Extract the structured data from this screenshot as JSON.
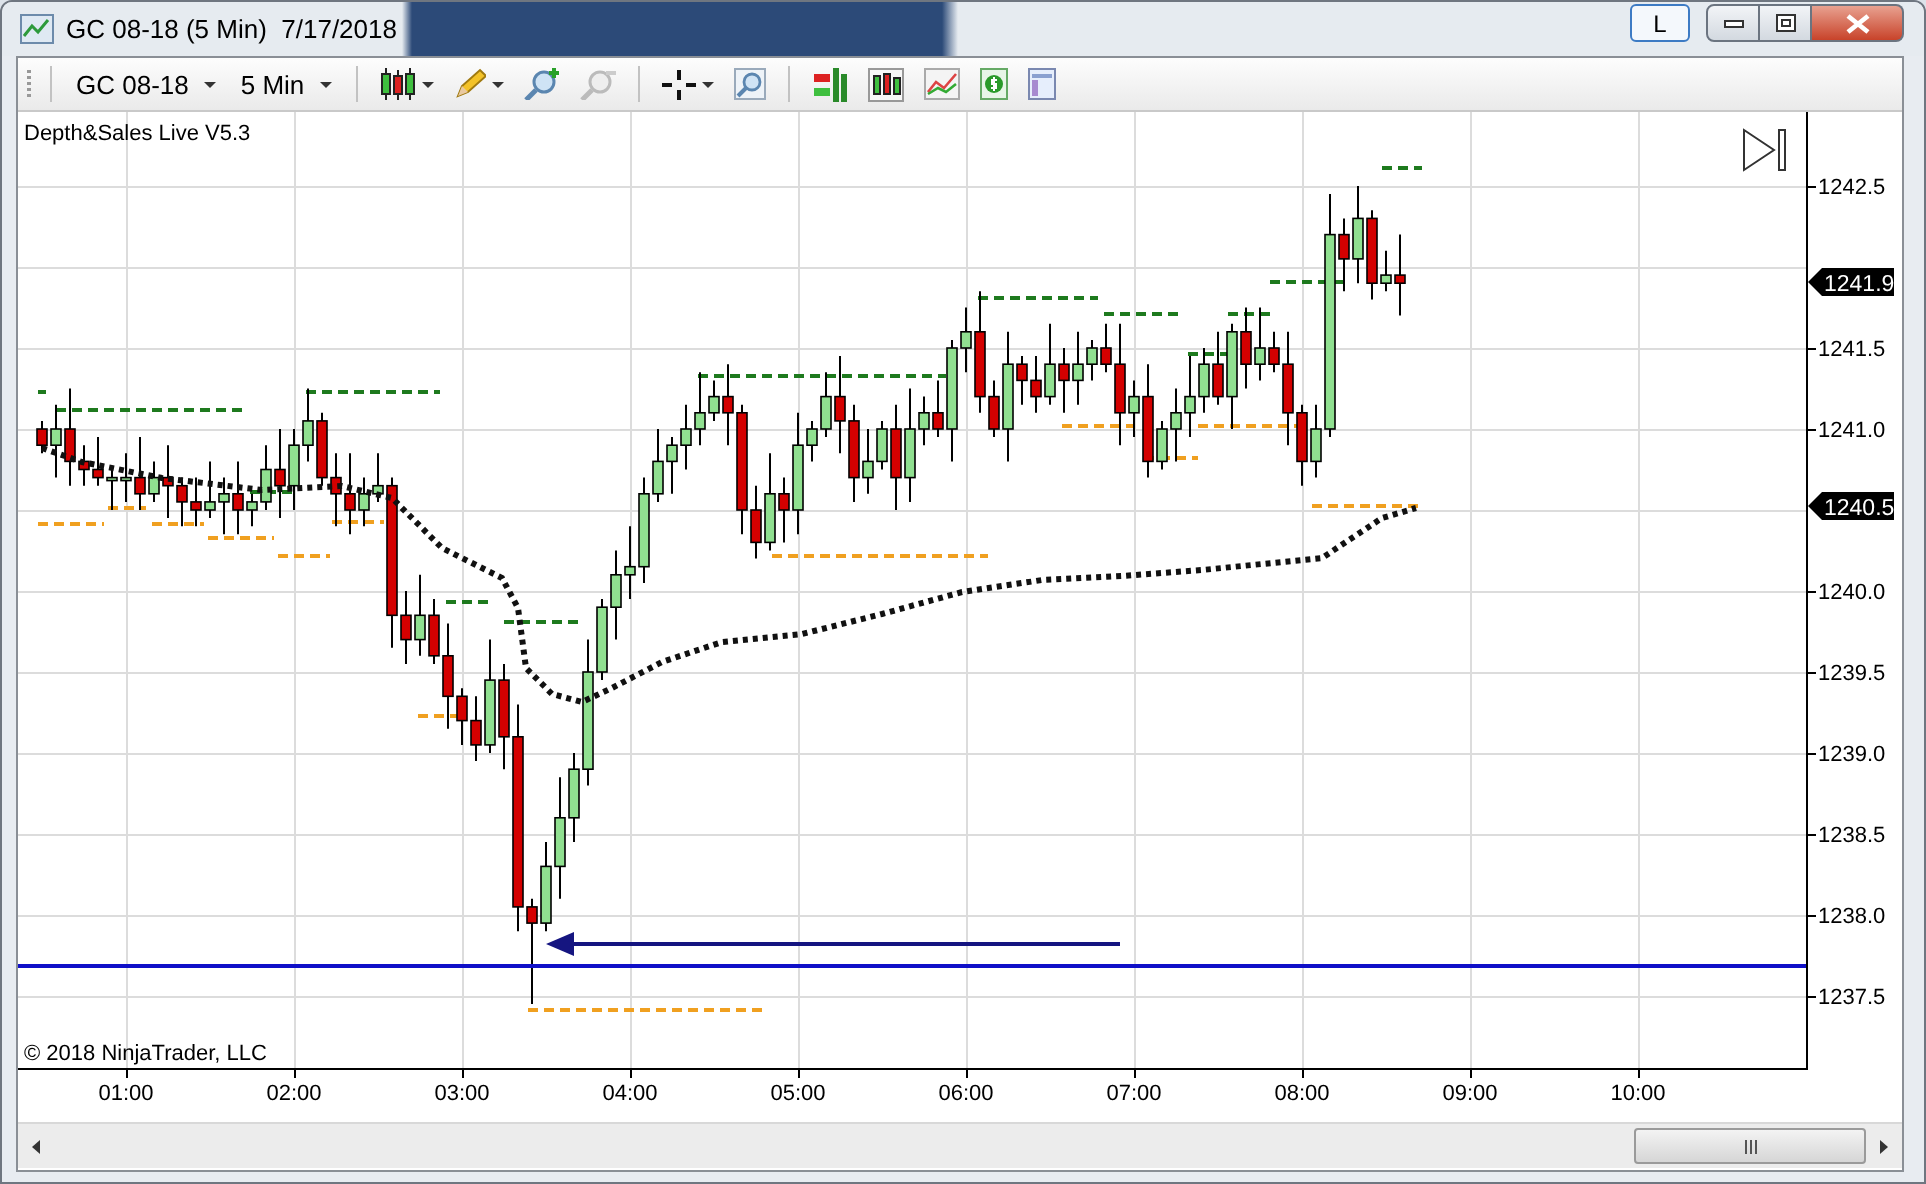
{
  "window": {
    "title": "GC 08-18 (5 Min)  7/17/2018",
    "link_button": "L"
  },
  "toolbar": {
    "instrument": "GC 08-18",
    "interval": "5 Min"
  },
  "chart": {
    "indicator_label": "Depth&Sales Live V5.3",
    "copyright": "© 2018 NinjaTrader, LLC",
    "price_ticks": [
      "1242.5",
      "1241.5",
      "1241.0",
      "1240.0",
      "1239.5",
      "1239.0",
      "1238.5",
      "1238.0",
      "1237.5"
    ],
    "price_markers": [
      {
        "label": "1241.9"
      },
      {
        "label": "1240.5"
      }
    ],
    "time_ticks": [
      "01:00",
      "02:00",
      "03:00",
      "04:00",
      "05:00",
      "06:00",
      "07:00",
      "08:00",
      "09:00",
      "10:00"
    ]
  }
}
